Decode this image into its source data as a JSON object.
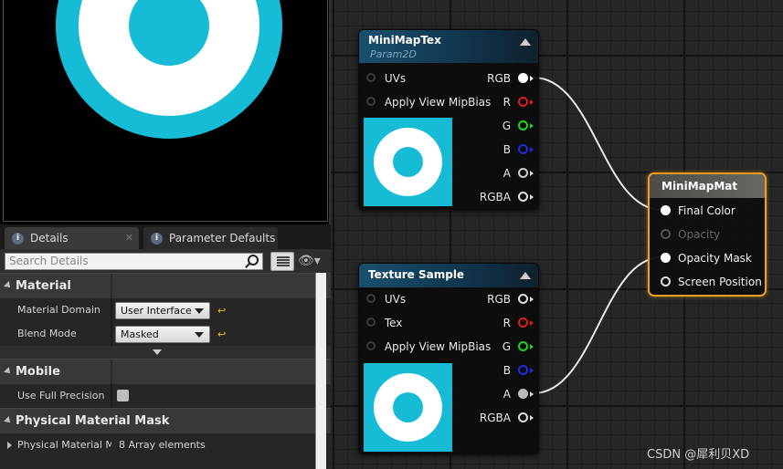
{
  "details_tabs": [
    {
      "label": "Details",
      "icon": "info-icon"
    },
    {
      "label": "Parameter Defaults",
      "icon": "info-icon"
    }
  ],
  "search": {
    "placeholder": "Search Details"
  },
  "categories": {
    "material": {
      "title": "Material",
      "domain_label": "Material Domain",
      "domain_value": "User Interface",
      "blend_label": "Blend Mode",
      "blend_value": "Masked"
    },
    "mobile": {
      "title": "Mobile",
      "precision_label": "Use Full Precision",
      "precision_checked": false
    },
    "physical_mask": {
      "title": "Physical Material Mask",
      "row_label": "Physical Material Mask",
      "row_value": "8 Array elements"
    }
  },
  "nodes": {
    "minimap_tex": {
      "title": "MiniMapTex",
      "subtitle": "Param2D",
      "inputs": [
        "UVs",
        "Apply View MipBias"
      ],
      "outputs": [
        "RGB",
        "R",
        "G",
        "B",
        "A",
        "RGBA"
      ]
    },
    "texture_sample": {
      "title": "Texture Sample",
      "inputs": [
        "UVs",
        "Tex",
        "Apply View MipBias"
      ],
      "outputs": [
        "RGB",
        "R",
        "G",
        "B",
        "A",
        "RGBA"
      ]
    },
    "material": {
      "title": "MiniMapMat",
      "inputs": [
        "Final Color",
        "Opacity",
        "Opacity Mask",
        "Screen Position"
      ]
    }
  },
  "pin_colors": {
    "R": "#e01b1b",
    "G": "#22d422",
    "B": "#1a2de0",
    "A": "#dddddd",
    "RGB": "#ffffff"
  },
  "watermark": "CSDN @犀利贝XD"
}
